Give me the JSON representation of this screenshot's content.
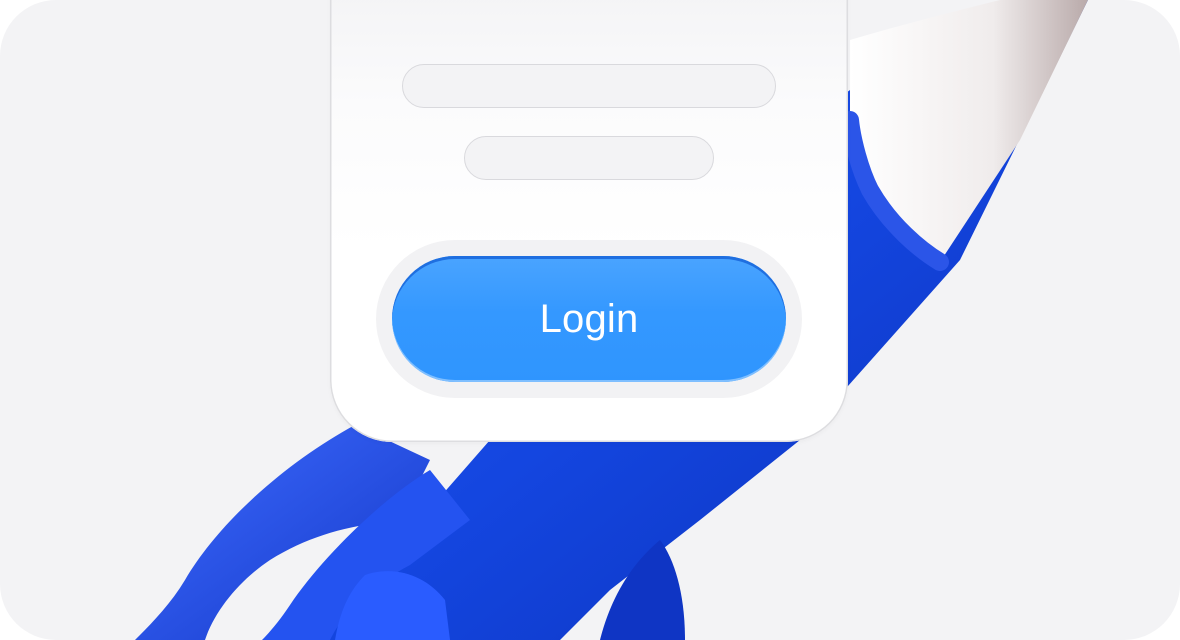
{
  "login_form": {
    "button_label": "Login"
  },
  "colors": {
    "background": "#f3f3f5",
    "card": "#ffffff",
    "accent_button": "#3498ff",
    "rocket_body": "#1446e0",
    "rocket_nose": "#eeeaea"
  },
  "icons": {
    "illustration": "rocket-illustration"
  }
}
